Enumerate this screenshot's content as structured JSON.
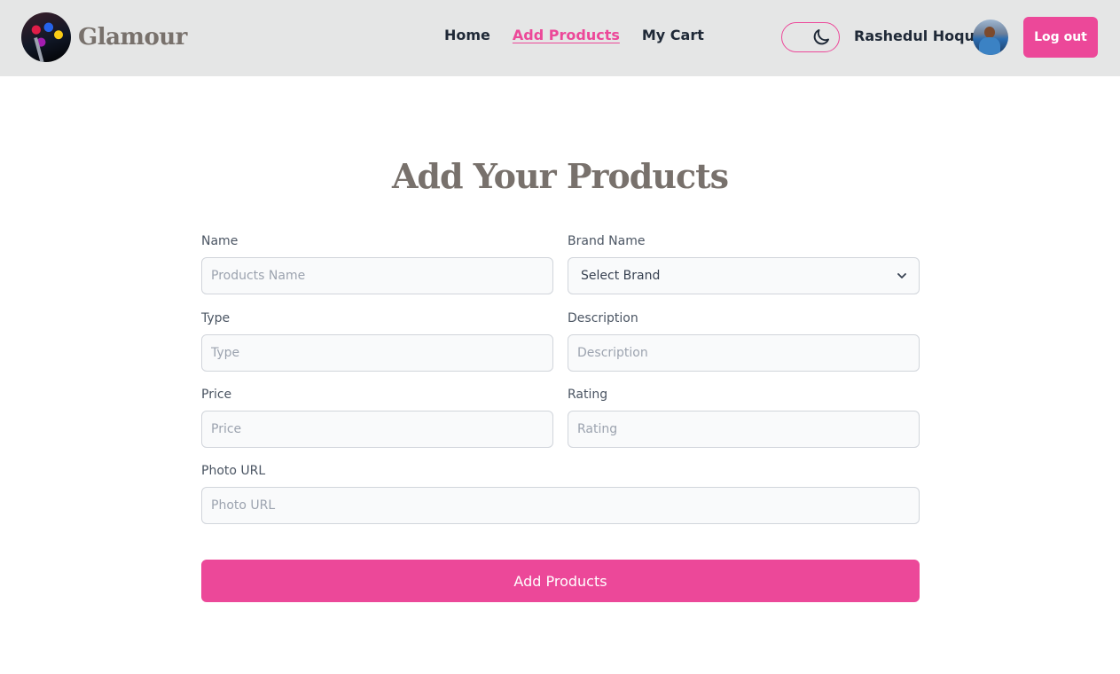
{
  "navbar": {
    "brand_name": "Glamour",
    "links": [
      {
        "label": "Home",
        "active": false
      },
      {
        "label": "Add Products",
        "active": true
      },
      {
        "label": "My Cart",
        "active": false
      }
    ],
    "user_name": "Rashedul Hoque",
    "logout_label": "Log out",
    "accent_color": "#ec4899"
  },
  "page": {
    "title": "Add Your Products"
  },
  "form": {
    "name": {
      "label": "Name",
      "placeholder": "Products Name",
      "value": ""
    },
    "brand": {
      "label": "Brand Name",
      "selected": "Select Brand"
    },
    "type": {
      "label": "Type",
      "placeholder": "Type",
      "value": ""
    },
    "description": {
      "label": "Description",
      "placeholder": "Description",
      "value": ""
    },
    "price": {
      "label": "Price",
      "placeholder": "Price",
      "value": ""
    },
    "rating": {
      "label": "Rating",
      "placeholder": "Rating",
      "value": ""
    },
    "photo": {
      "label": "Photo URL",
      "placeholder": "Photo URL",
      "value": ""
    },
    "submit_label": "Add Products"
  }
}
